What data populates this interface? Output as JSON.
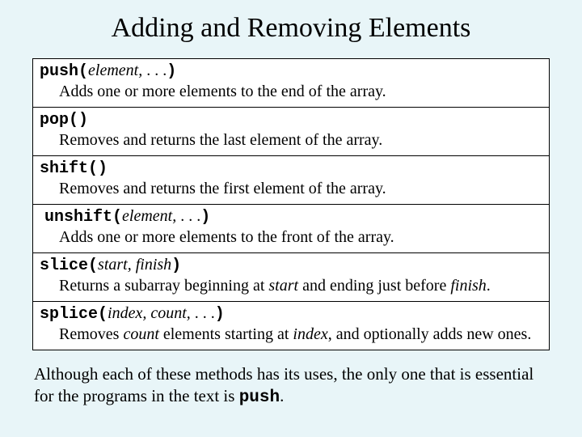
{
  "title": "Adding and Removing Elements",
  "methods": [
    {
      "name": "push",
      "open": "(",
      "args_ital": "element,",
      "args_plain": " . . .",
      "close": ")",
      "desc": "Adds one or more elements to the end of the array."
    },
    {
      "name": "pop",
      "open": "()",
      "args_ital": "",
      "args_plain": "",
      "close": "",
      "desc": "Removes and returns the last element of the array."
    },
    {
      "name": "shift",
      "open": "()",
      "args_ital": "",
      "args_plain": "",
      "close": "",
      "desc": "Removes and returns the first element of the array."
    },
    {
      "name": "unshift",
      "open": "(",
      "args_ital": "element,",
      "args_plain": " . . .",
      "close": ")",
      "desc": "Adds one or more elements to the front of the array.",
      "pad": true
    },
    {
      "name": "slice",
      "open": "(",
      "args_ital": "start, finish",
      "args_plain": "",
      "close": ")",
      "desc_html": "Returns a subarray beginning at <span class=\"ital\">start</span> and ending just before <span class=\"ital\">finish</span>."
    },
    {
      "name": "splice",
      "open": "(",
      "args_ital": "index, count,",
      "args_plain": " . . .",
      "close": ")",
      "desc_html": "Removes <span class=\"ital\">count</span> elements starting at <span class=\"ital\">index</span>, and optionally adds new ones."
    }
  ],
  "note_pre": "Although each of these methods has its uses, the only one that is essential for the programs in the text is ",
  "note_code": "push",
  "note_post": "."
}
